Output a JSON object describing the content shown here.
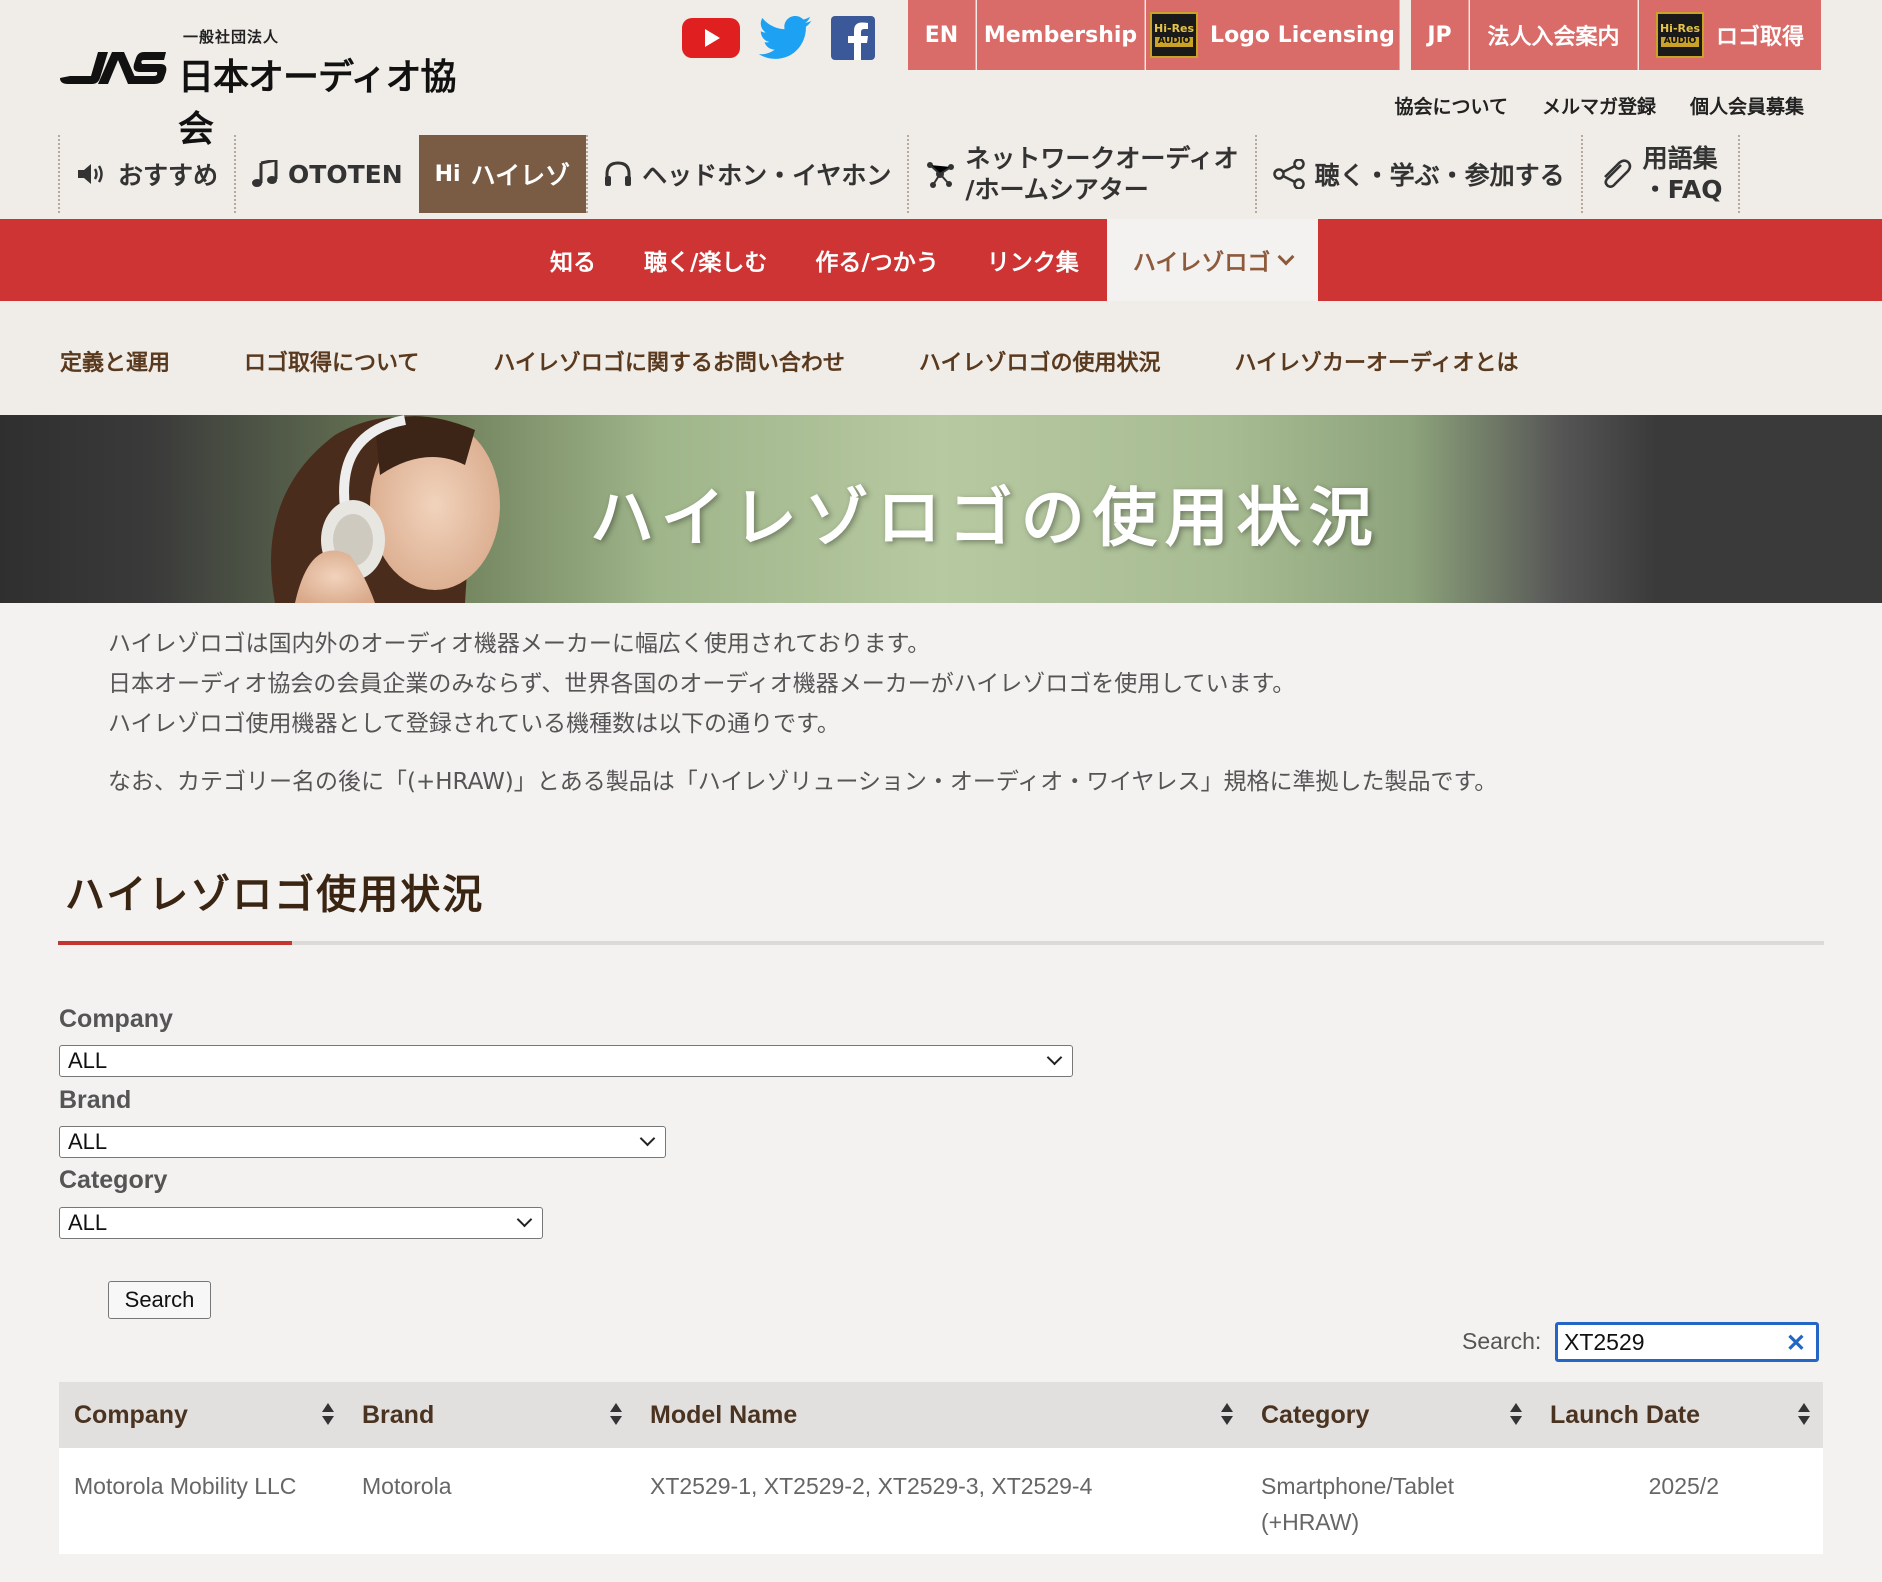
{
  "header": {
    "logo_subtitle": "一般社団法人",
    "logo_name": "日本オーディオ協会",
    "top_tabs": {
      "en": "EN",
      "membership": "Membership",
      "logo_licensing": "Logo Licensing",
      "jp": "JP",
      "corp_membership": "法人入会案内",
      "logo_get": "ロゴ取得"
    },
    "hires_badge": {
      "top": "Hi-Res",
      "bottom": "AUDIO"
    },
    "sub_links": [
      "協会について",
      "メルマガ登録",
      "個人会員募集"
    ],
    "main_nav": {
      "recommend": "おすすめ",
      "ototen": "OTOTEN",
      "hires_prefix": "Hi",
      "hires": "ハイレゾ",
      "headphones": "ヘッドホン・イヤホン",
      "network_line1": "ネットワークオーディオ",
      "network_line2": "/ホームシアター",
      "listen": "聴く・学ぶ・参加する",
      "glossary_line1": "用語集",
      "glossary_line2": "・FAQ"
    }
  },
  "red_nav": [
    "知る",
    "聴く/楽しむ",
    "作る/つかう",
    "リンク集",
    "ハイレゾロゴ"
  ],
  "sub_nav": [
    "定義と運用",
    "ロゴ取得について",
    "ハイレゾロゴに関するお問い合わせ",
    "ハイレゾロゴの使用状況",
    "ハイレゾカーオーディオとは"
  ],
  "hero": {
    "title": "ハイレゾロゴの使用状況"
  },
  "intro": {
    "line1": "ハイレゾロゴは国内外のオーディオ機器メーカーに幅広く使用されております。",
    "line2": "日本オーディオ協会の会員企業のみならず、世界各国のオーディオ機器メーカーがハイレゾロゴを使用しています。",
    "line3": "ハイレゾロゴ使用機器として登録されている機種数は以下の通りです。",
    "note": "なお、カテゴリー名の後に「(+HRAW)」とある製品は「ハイレゾリューション・オーディオ・ワイヤレス」規格に準拠した製品です。"
  },
  "section_title": "ハイレゾロゴ使用状況",
  "form": {
    "company_label": "Company",
    "company_value": "ALL",
    "brand_label": "Brand",
    "brand_value": "ALL",
    "category_label": "Category",
    "category_value": "ALL",
    "search_button": "Search"
  },
  "table_search": {
    "label": "Search:",
    "value": "XT2529",
    "clear": "✕"
  },
  "table": {
    "headers": [
      "Company",
      "Brand",
      "Model Name",
      "Category",
      "Launch Date"
    ],
    "rows": [
      {
        "company": "Motorola Mobility LLC",
        "brand": "Motorola",
        "model": "XT2529-1, XT2529-2, XT2529-3, XT2529-4",
        "category_line1": "Smartphone/Tablet",
        "category_line2": "(+HRAW)",
        "launch": "2025/2"
      }
    ]
  },
  "colors": {
    "tab_red": "#d96b68",
    "bar_red": "#cd3433",
    "brown": "#7a5c44",
    "accent_blue": "#2466c6"
  }
}
